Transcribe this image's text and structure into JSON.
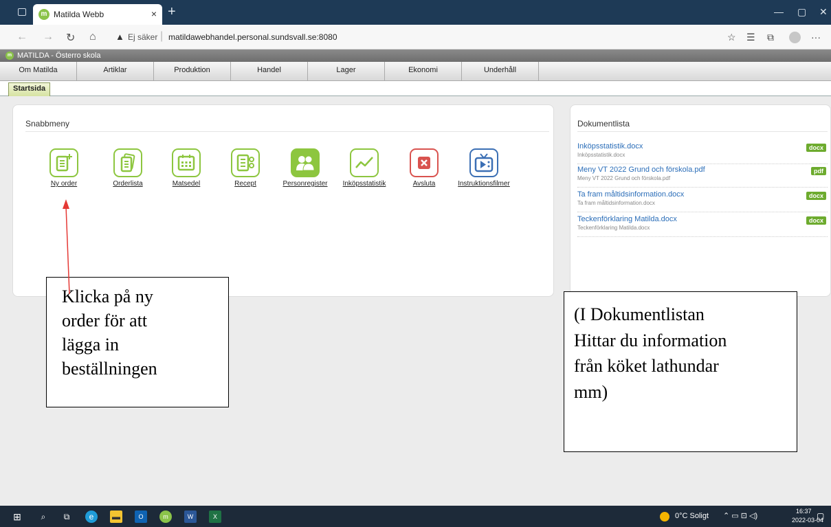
{
  "browser": {
    "tab_title": "Matilda Webb",
    "tab_close": "×",
    "new_tab": "+",
    "security_label": "Ej säker",
    "url": "matildawebhandel.personal.sundsvall.se:8080"
  },
  "app": {
    "title": "MATILDA - Österro skola",
    "logo_letter": "m"
  },
  "menu": [
    {
      "label": "Om Matilda"
    },
    {
      "label": "Artiklar"
    },
    {
      "label": "Produktion"
    },
    {
      "label": "Handel"
    },
    {
      "label": "Lager"
    },
    {
      "label": "Ekonomi"
    },
    {
      "label": "Underhåll"
    }
  ],
  "start_tab": "Startsida",
  "snabbmeny": {
    "title": "Snabbmeny",
    "items": [
      {
        "label": "Ny order",
        "icon": "new-order-icon",
        "color": "#8dc63f"
      },
      {
        "label": "Orderlista",
        "icon": "order-list-icon",
        "color": "#8dc63f"
      },
      {
        "label": "Matsedel",
        "icon": "calendar-icon",
        "color": "#8dc63f"
      },
      {
        "label": "Recept",
        "icon": "recipe-icon",
        "color": "#8dc63f"
      },
      {
        "label": "Personregister",
        "icon": "people-icon",
        "color": "#8dc63f"
      },
      {
        "label": "Inköpsstatistik",
        "icon": "chart-icon",
        "color": "#8dc63f"
      },
      {
        "label": "Avsluta",
        "icon": "close-icon",
        "color": "#d9534f"
      },
      {
        "label": "Instruktionsfilmer",
        "icon": "tv-icon",
        "color": "#3b6fb4"
      }
    ]
  },
  "dokumentlista": {
    "title": "Dokumentlista",
    "items": [
      {
        "name": "Inköpsstatistik.docx",
        "sub": "Inköpsstatistik.docx",
        "badge": "docx"
      },
      {
        "name": "Meny VT 2022 Grund och förskola.pdf",
        "sub": "Meny VT 2022 Grund och förskola.pdf",
        "badge": "pdf"
      },
      {
        "name": "Ta fram måltidsinformation.docx",
        "sub": "Ta fram måltidsinformation.docx",
        "badge": "docx"
      },
      {
        "name": "Teckenförklaring Matilda.docx",
        "sub": "Teckenförklaring Matilda.docx",
        "badge": "docx"
      }
    ]
  },
  "callouts": {
    "left": [
      "Klicka på ny",
      "order för att",
      "lägga in",
      "beställningen"
    ],
    "right": [
      "(I Dokumentlistan",
      "Hittar du information",
      "från köket lathundar",
      "mm)"
    ]
  },
  "taskbar": {
    "weather": "0°C Soligt",
    "time": "16:37",
    "date": "2022-03-04"
  },
  "colors": {
    "green_accent": "#8dc63f",
    "badge_green": "#6dab2e",
    "link_blue": "#2a6db8",
    "tabbar": "#1e3a56",
    "arrow_red": "#e53935"
  }
}
